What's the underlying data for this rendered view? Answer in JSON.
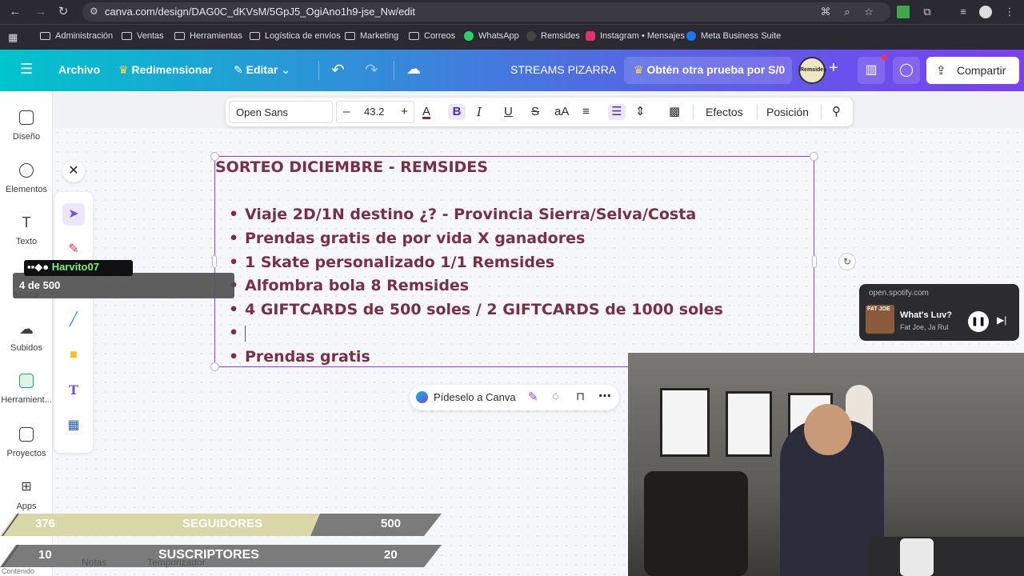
{
  "browser": {
    "url": "canva.com/design/DAG0C_dKVsM/5GpJ5_OgiAno1h9-jse_Nw/edit",
    "bookmarks": [
      {
        "label": "Administración",
        "icon": "folder-icon"
      },
      {
        "label": "Ventas",
        "icon": "folder-icon"
      },
      {
        "label": "Herramientas",
        "icon": "folder-icon"
      },
      {
        "label": "Logística de envíos",
        "icon": "folder-icon"
      },
      {
        "label": "Marketing",
        "icon": "folder-icon"
      },
      {
        "label": "Correos",
        "icon": "folder-icon"
      },
      {
        "label": "WhatsApp",
        "icon": "whatsapp-icon"
      },
      {
        "label": "Remsides",
        "icon": "remsides-icon"
      },
      {
        "label": "Instagram • Mensajes",
        "icon": "instagram-icon"
      },
      {
        "label": "Meta Business Suite",
        "icon": "meta-icon"
      }
    ]
  },
  "header": {
    "menu_icon": "hamburger-icon",
    "file": "Archivo",
    "resize": "Redimensionar",
    "edit": "Editar",
    "design_title": "STREAMS PIZARRA",
    "trial": "Obtén otra prueba por S/0",
    "avatar_text": "Remsides",
    "share": "Compartir"
  },
  "sidebar": {
    "items": [
      {
        "label": "Diseño",
        "icon": "layout-icon"
      },
      {
        "label": "Elementos",
        "icon": "shapes-icon"
      },
      {
        "label": "Texto",
        "icon": "text-icon"
      },
      {
        "label": "Marca",
        "icon": "brand-icon"
      },
      {
        "label": "Subidos",
        "icon": "upload-cloud-icon"
      },
      {
        "label": "Herramient...",
        "icon": "draw-icon"
      },
      {
        "label": "Proyectos",
        "icon": "folder-icon"
      },
      {
        "label": "Apps",
        "icon": "apps-icon"
      }
    ]
  },
  "toolbar": {
    "font": "Open Sans",
    "font_size": "43.2",
    "effects": "Efectos",
    "position": "Posición"
  },
  "canvas": {
    "title": "SORTEO DICIEMBRE - REMSIDES",
    "bullets": [
      "Viaje 2D/1N destino ¿? - Provincia Sierra/Selva/Costa",
      "Prendas gratis de por vida X ganadores",
      "1 Skate personalizado 1/1 Remsides",
      "Alfombra bola 8 Remsides",
      "4 GIFTCARDS de 500 soles / 2 GIFTCARDS de 1000 soles",
      "",
      "Prendas gratis"
    ],
    "text_color": "#7a2f45",
    "selection_color": "#8b3dff"
  },
  "ai_bar": {
    "label": "Pídeselo a Canva"
  },
  "overlay": {
    "user_tag": "Harvito07",
    "progress": "4 de 500"
  },
  "spotify": {
    "site": "open.spotify.com",
    "song": "What's Luv?",
    "artist": "Fat Joe, Ja Rul",
    "cover_text": "FAT JOE"
  },
  "stats": {
    "followers_current": "376",
    "followers_label": "SEGUIDORES",
    "followers_goal": "500",
    "subs_current": "10",
    "subs_label": "SUSCRIPTORES",
    "subs_goal": "20"
  },
  "footer": {
    "notes": "Notas",
    "timer": "Temporizador",
    "content": "Contenido"
  }
}
